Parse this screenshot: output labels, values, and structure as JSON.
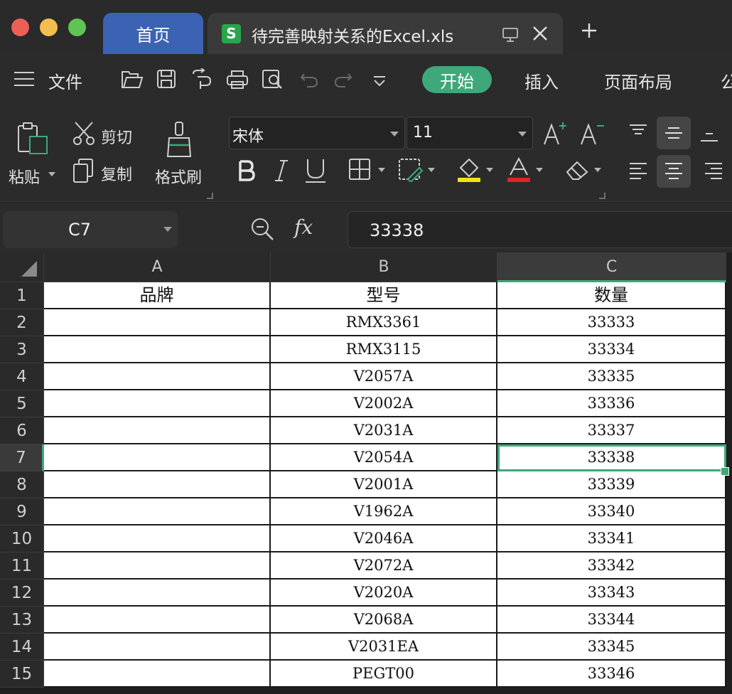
{
  "titlebar": {
    "home_tab": "首页",
    "doc_icon_letter": "S",
    "doc_title": "待完善映射关系的Excel.xls",
    "add_tab": "+"
  },
  "menu": {
    "file": "文件",
    "start": "开始",
    "insert": "插入",
    "page_layout": "页面布局",
    "formula_partial": "公"
  },
  "ribbon": {
    "paste": "粘贴",
    "cut": "剪切",
    "copy": "复制",
    "format_painter": "格式刷",
    "font_name": "宋体",
    "font_size": "11"
  },
  "formula": {
    "cell_ref": "C7",
    "fx_label": "fx",
    "value": "33338"
  },
  "sheet": {
    "columns": [
      "A",
      "B",
      "C"
    ],
    "active_column": "C",
    "active_row": 7,
    "rows": [
      {
        "num": "1",
        "a": "品牌",
        "b": "型号",
        "c": "数量"
      },
      {
        "num": "2",
        "a": "",
        "b": "RMX3361",
        "c": "33333"
      },
      {
        "num": "3",
        "a": "",
        "b": "RMX3115",
        "c": "33334"
      },
      {
        "num": "4",
        "a": "",
        "b": "V2057A",
        "c": "33335"
      },
      {
        "num": "5",
        "a": "",
        "b": "V2002A",
        "c": "33336"
      },
      {
        "num": "6",
        "a": "",
        "b": "V2031A",
        "c": "33337"
      },
      {
        "num": "7",
        "a": "",
        "b": "V2054A",
        "c": "33338"
      },
      {
        "num": "8",
        "a": "",
        "b": "V2001A",
        "c": "33339"
      },
      {
        "num": "9",
        "a": "",
        "b": "V1962A",
        "c": "33340"
      },
      {
        "num": "10",
        "a": "",
        "b": "V2046A",
        "c": "33341"
      },
      {
        "num": "11",
        "a": "",
        "b": "V2072A",
        "c": "33342"
      },
      {
        "num": "12",
        "a": "",
        "b": "V2020A",
        "c": "33343"
      },
      {
        "num": "13",
        "a": "",
        "b": "V2068A",
        "c": "33344"
      },
      {
        "num": "14",
        "a": "",
        "b": "V2031EA",
        "c": "33345"
      },
      {
        "num": "15",
        "a": "",
        "b": "PEGT00",
        "c": "33346"
      }
    ]
  },
  "colors": {
    "accent": "#3fa87a",
    "home_tab": "#3b62b3"
  }
}
